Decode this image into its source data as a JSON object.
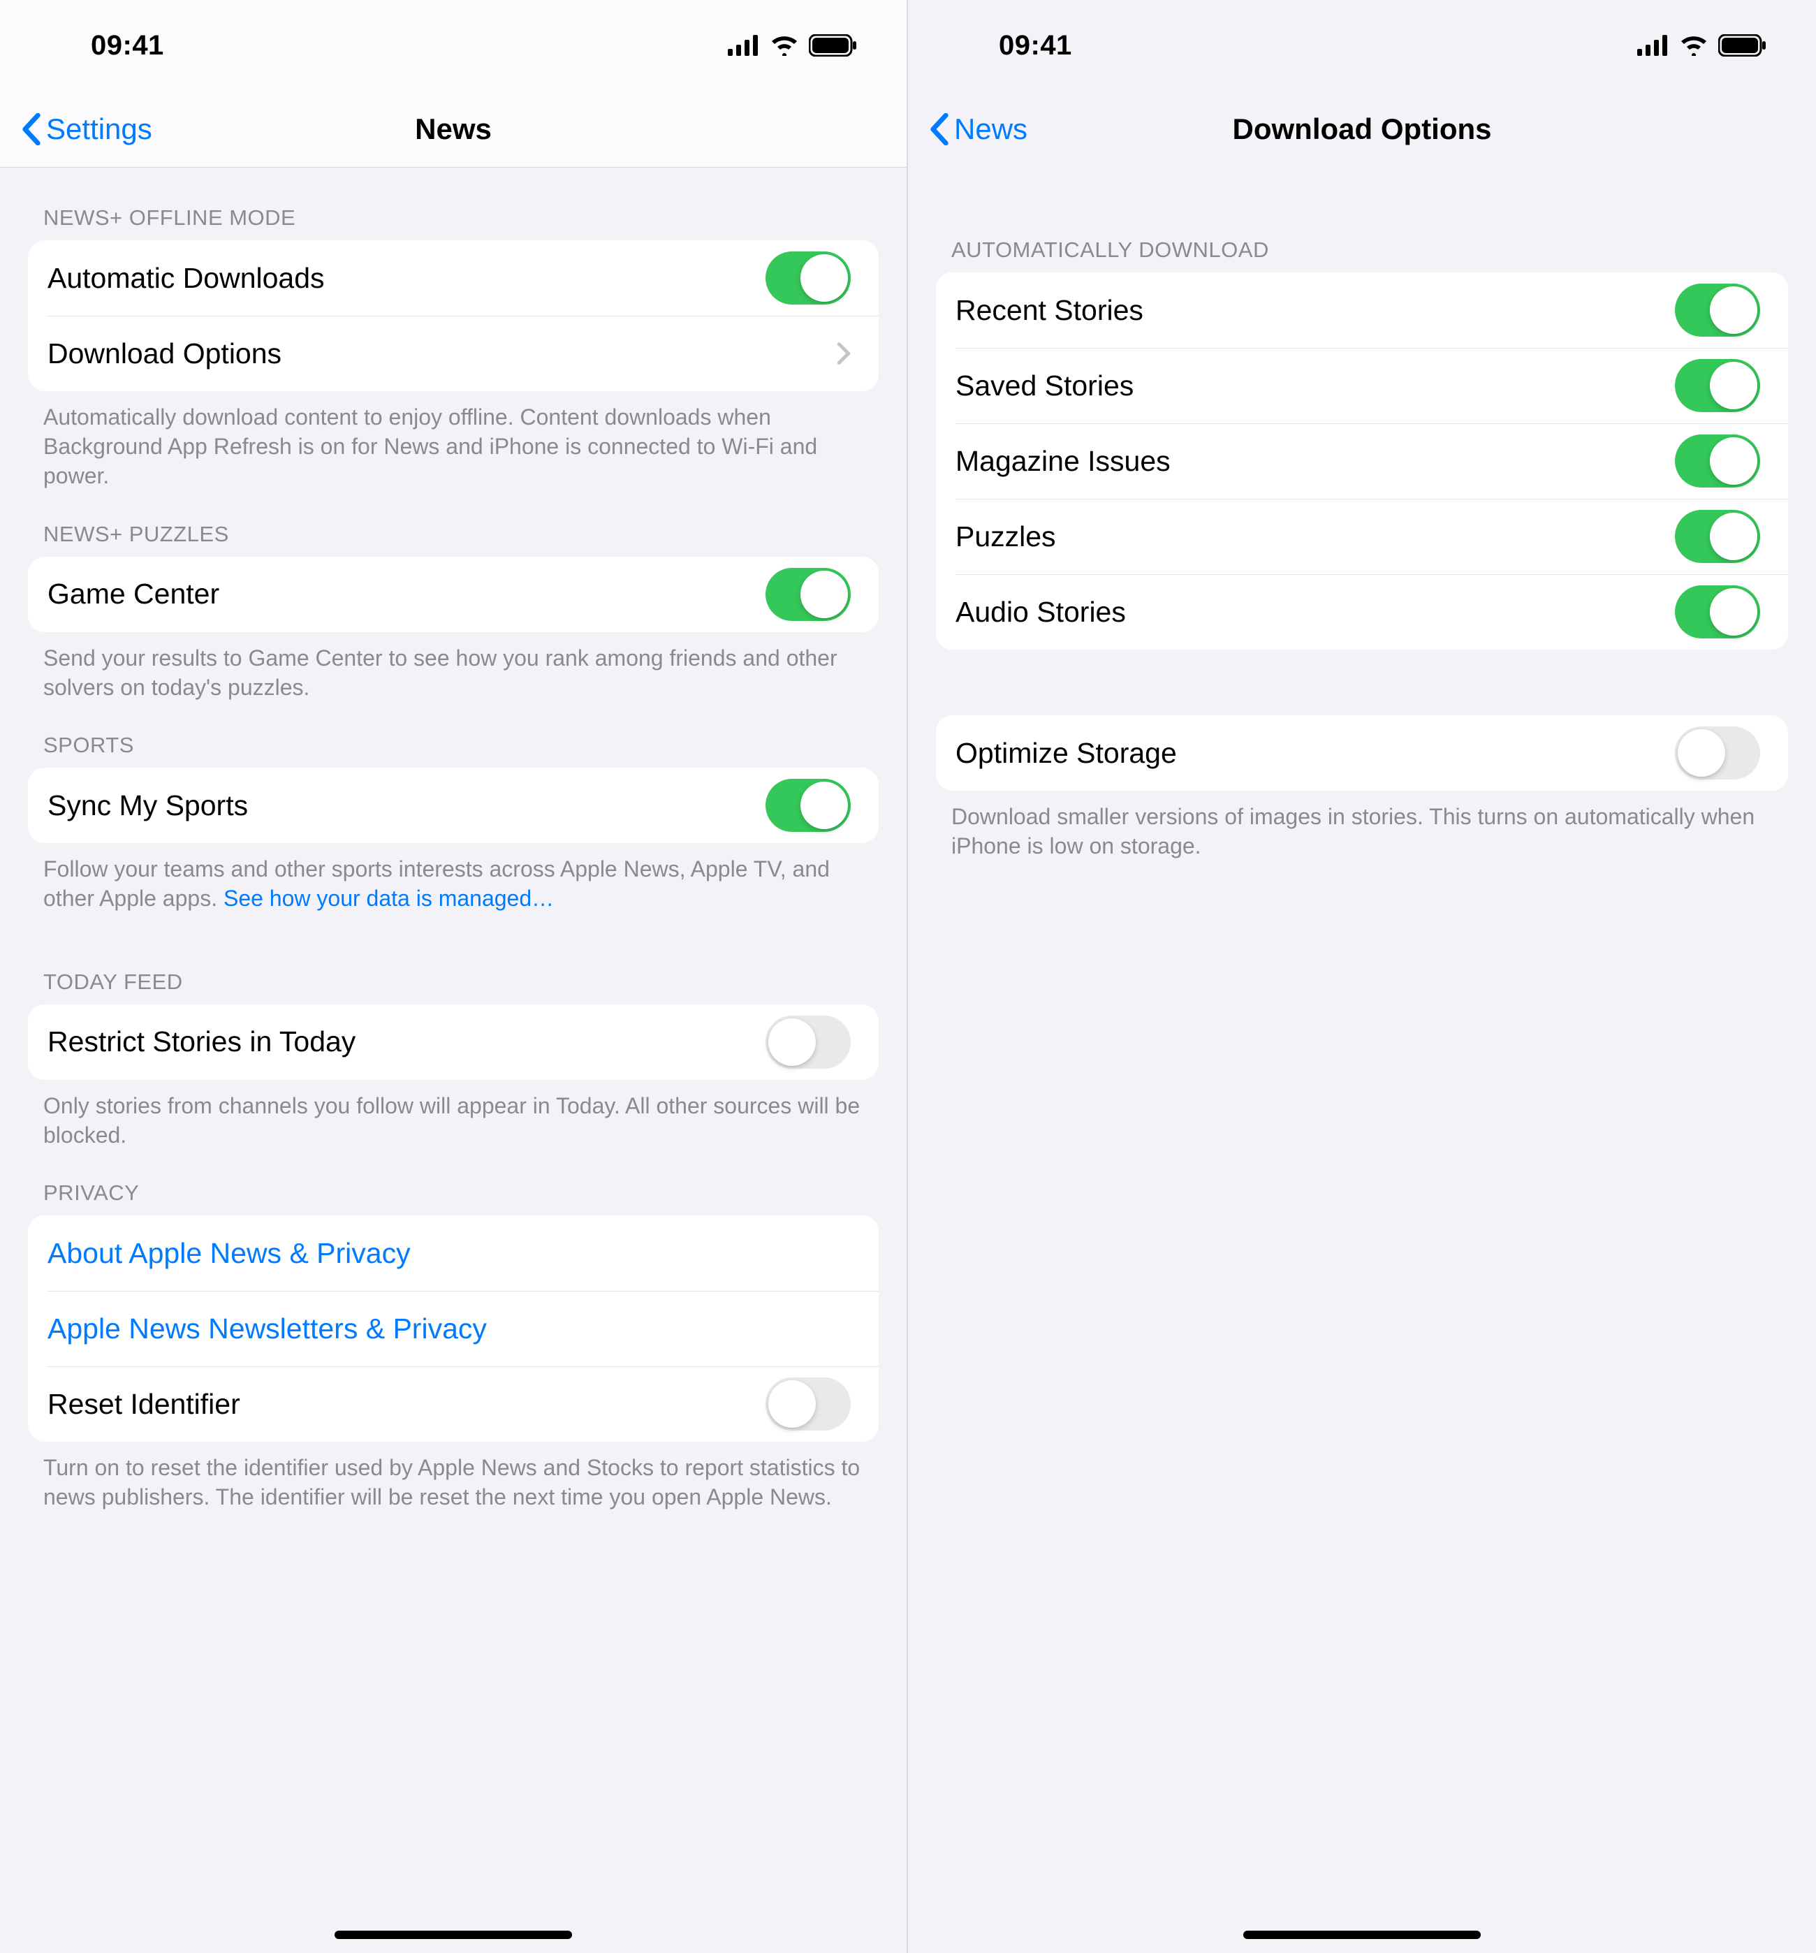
{
  "status": {
    "time": "09:41"
  },
  "left": {
    "back": "Settings",
    "title": "News",
    "sections": {
      "offline": {
        "header": "NEWS+ OFFLINE MODE",
        "auto_dl": "Automatic Downloads",
        "dl_options": "Download Options",
        "footer": "Automatically download content to enjoy offline. Content downloads when Background App Refresh is on for News and iPhone is connected to Wi-Fi and power."
      },
      "puzzles": {
        "header": "NEWS+ PUZZLES",
        "game_center": "Game Center",
        "footer": "Send your results to Game Center to see how you rank among friends and other solvers on today's puzzles."
      },
      "sports": {
        "header": "SPORTS",
        "sync": "Sync My Sports",
        "footer_text": "Follow your teams and other sports interests across Apple News, Apple TV, and other Apple apps. ",
        "footer_link": "See how your data is managed…"
      },
      "today": {
        "header": "TODAY FEED",
        "restrict": "Restrict Stories in Today",
        "footer": "Only stories from channels you follow will appear in Today. All other sources will be blocked."
      },
      "privacy": {
        "header": "PRIVACY",
        "about": "About Apple News & Privacy",
        "newsletters": "Apple News Newsletters & Privacy",
        "reset": "Reset Identifier",
        "footer": "Turn on to reset the identifier used by Apple News and Stocks to report statistics to news publishers. The identifier will be reset the next time you open Apple News."
      }
    }
  },
  "right": {
    "back": "News",
    "title": "Download Options",
    "auto_header": "AUTOMATICALLY DOWNLOAD",
    "items": {
      "recent": "Recent Stories",
      "saved": "Saved Stories",
      "magazine": "Magazine Issues",
      "puzzles": "Puzzles",
      "audio": "Audio Stories"
    },
    "optimize": "Optimize Storage",
    "optimize_footer": "Download smaller versions of images in stories. This turns on automatically when iPhone is low on storage."
  }
}
